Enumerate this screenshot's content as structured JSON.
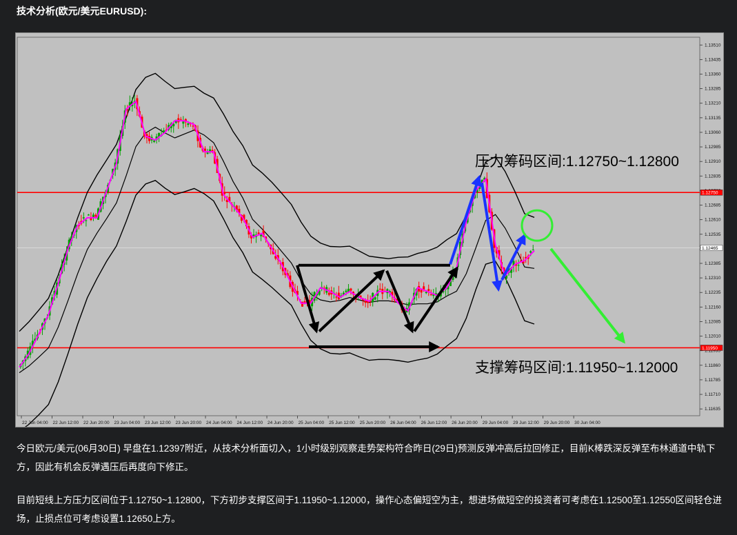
{
  "heading": "技术分析(欧元/美元EURUSD):",
  "paragraphs": [
    "今日欧元/美元(06月30日) 早盘在1.12397附近，从技术分析面切入，1小时级别观察走势架构符合昨日(29日)预测反弹冲高后拉回修正，目前K棒跌深反弹至布林通道中轨下方，因此有机会反弹遇压后再度向下修正。",
    "目前短线上方压力区间位于1.12750~1.12800，下方初步支撑区间于1.11950~1.12000，操作心态偏短空为主，想进场做短空的投资者可考虑在1.12500至1.12550区间轻仓进场，止损点位可考虑设置1.12650上方。"
  ],
  "chart_data": {
    "type": "candlestick",
    "instrument": "EURUSD",
    "timeframe": "H1",
    "ylim": [
      1.116,
      1.1355
    ],
    "y_ticks": [
      "1.13510",
      "1.13435",
      "1.13360",
      "1.13285",
      "1.13210",
      "1.13135",
      "1.13060",
      "1.12985",
      "1.12910",
      "1.12835",
      "1.12760",
      "1.12685",
      "1.12610",
      "1.12535",
      "1.12465",
      "1.12385",
      "1.12310",
      "1.12235",
      "1.12160",
      "1.12085",
      "1.12010",
      "1.11935",
      "1.11860",
      "1.11785",
      "1.11710",
      "1.11635"
    ],
    "x_ticks": [
      "22 Jun 04:00",
      "22 Jun 12:00",
      "22 Jun 20:00",
      "23 Jun 04:00",
      "23 Jun 12:00",
      "23 Jun 20:00",
      "24 Jun 04:00",
      "24 Jun 12:00",
      "24 Jun 20:00",
      "25 Jun 04:00",
      "25 Jun 12:00",
      "25 Jun 20:00",
      "26 Jun 04:00",
      "26 Jun 12:00",
      "26 Jun 20:00",
      "29 Jun 04:00",
      "29 Jun 12:00",
      "29 Jun 20:00",
      "30 Jun 04:00"
    ],
    "price_path": [
      1.1185,
      1.1192,
      1.1202,
      1.1212,
      1.1228,
      1.1246,
      1.1258,
      1.1262,
      1.1262,
      1.1276,
      1.129,
      1.1318,
      1.1322,
      1.1304,
      1.1302,
      1.1306,
      1.1312,
      1.1312,
      1.131,
      1.1296,
      1.1296,
      1.1274,
      1.1268,
      1.1262,
      1.1252,
      1.1254,
      1.1246,
      1.1238,
      1.1228,
      1.1218,
      1.1218,
      1.1226,
      1.1224,
      1.1221,
      1.1224,
      1.1221,
      1.1219,
      1.1224,
      1.1224,
      1.1218,
      1.1214,
      1.1226,
      1.1224,
      1.1222,
      1.1226,
      1.1236,
      1.126,
      1.1276,
      1.1282,
      1.1248,
      1.1232,
      1.1238,
      1.124,
      1.1245
    ],
    "horizontal_lines": [
      {
        "price": "1.12750",
        "color": "#ff0000"
      },
      {
        "price": "1.11950",
        "color": "#ff0000"
      },
      {
        "price": "1.12465",
        "color": "#d8d8d8"
      }
    ],
    "annotations": [
      {
        "text": "压力筹码区间:1.12750~1.12800"
      },
      {
        "text": "支撑筹码区间:1.11950~1.12000"
      }
    ],
    "colors": {
      "up": "#00a000",
      "down": "#ff0000",
      "ma": "#ff00ff",
      "bands": "#000000",
      "pattern": "#000000",
      "projection_up": "#1a33ff",
      "projection_down": "#33ee33"
    }
  }
}
